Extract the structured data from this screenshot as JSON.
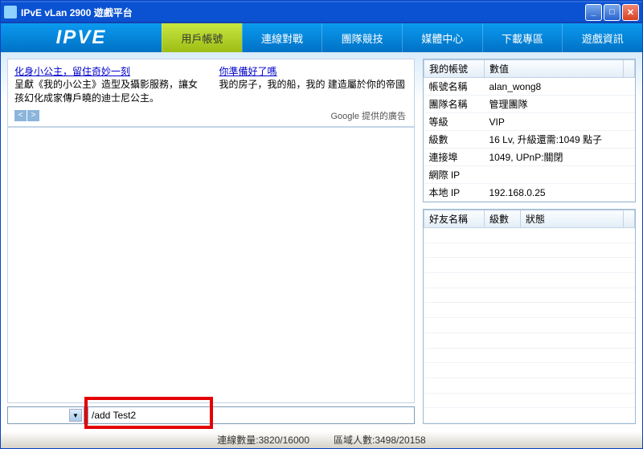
{
  "window": {
    "title": "IPvE vLan 2900 遊戲平台"
  },
  "logo_text": "IPVE",
  "nav": {
    "tabs": [
      {
        "label": "用戶帳號",
        "active": true
      },
      {
        "label": "連線對戰"
      },
      {
        "label": "團隊競技"
      },
      {
        "label": "媒體中心"
      },
      {
        "label": "下載專區"
      },
      {
        "label": "遊戲資訊"
      }
    ]
  },
  "ads": {
    "left": {
      "title": "化身小公主，留住奇妙一刻",
      "body": "呈獻《我的小公主》造型及攝影服務，讓女孩幻化成家傳戶曉的迪士尼公主。"
    },
    "right": {
      "title": "你準備好了嗎",
      "body": "我的房子，我的船，我的 建造屬於你的帝國"
    },
    "provider": "Google 提供的廣告",
    "prev": "<",
    "next": ">"
  },
  "account": {
    "head1": "我的帳號",
    "head2": "數值",
    "rows": [
      {
        "k": "帳號名稱",
        "v": "alan_wong8"
      },
      {
        "k": "團隊名稱",
        "v": "管理團隊"
      },
      {
        "k": "等級",
        "v": "VIP"
      },
      {
        "k": "級數",
        "v": "16 Lv, 升級還需:1049 點子"
      },
      {
        "k": "連接埠",
        "v": "1049, UPnP:關閉"
      },
      {
        "k": "網際 IP",
        "v": ""
      },
      {
        "k": "本地 IP",
        "v": "192.168.0.25"
      }
    ]
  },
  "friends": {
    "head1": "好友名稱",
    "head2": "級數",
    "head3": "狀態"
  },
  "input": {
    "value": "/add Test2"
  },
  "status": {
    "conn": "連線數量:3820/16000",
    "area": "區域人數:3498/20158"
  }
}
